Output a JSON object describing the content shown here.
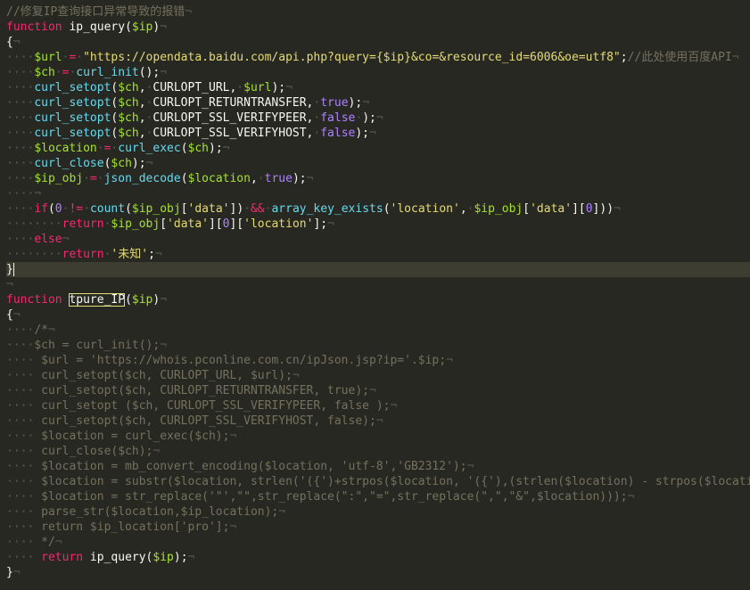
{
  "editor": {
    "language": "php",
    "theme_colors": {
      "background": "#272822",
      "current_line": "#3e3d32",
      "keyword": "#f92672",
      "function": "#66d9ef",
      "variable": "#a6e22e",
      "string": "#e6db74",
      "constant": "#ae81ff",
      "comment": "#75715e",
      "whitespace": "#595a4e"
    },
    "lines": [
      [
        [
          "com",
          "//修复IP查询接口异常导致的报错"
        ],
        [
          "ws",
          "¬"
        ]
      ],
      [
        [
          "kw",
          "function"
        ],
        [
          "plain",
          " ip_query("
        ],
        [
          "var",
          "$ip"
        ],
        [
          "plain",
          ")"
        ],
        [
          "ws",
          "¬"
        ]
      ],
      [
        [
          "plain",
          "{"
        ],
        [
          "ws",
          "¬"
        ]
      ],
      [
        [
          "ws",
          "····"
        ],
        [
          "var",
          "$url"
        ],
        [
          "ws",
          "·"
        ],
        [
          "kw",
          "="
        ],
        [
          "ws",
          "·"
        ],
        [
          "str",
          "\"https://opendata.baidu.com/api.php?query={$ip}&co=&resource_id=6006&oe=utf8\""
        ],
        [
          "plain",
          ";"
        ],
        [
          "com",
          "//此处使用百度API"
        ],
        [
          "ws",
          "¬"
        ]
      ],
      [
        [
          "ws",
          "····"
        ],
        [
          "var",
          "$ch"
        ],
        [
          "ws",
          "·"
        ],
        [
          "kw",
          "="
        ],
        [
          "ws",
          "·"
        ],
        [
          "fn",
          "curl_init"
        ],
        [
          "plain",
          "();"
        ],
        [
          "ws",
          "¬"
        ]
      ],
      [
        [
          "ws",
          "····"
        ],
        [
          "fn",
          "curl_setopt"
        ],
        [
          "plain",
          "("
        ],
        [
          "var",
          "$ch"
        ],
        [
          "plain",
          ","
        ],
        [
          "ws",
          "·"
        ],
        [
          "plain",
          "CURLOPT_URL,"
        ],
        [
          "ws",
          "·"
        ],
        [
          "var",
          "$url"
        ],
        [
          "plain",
          ");"
        ],
        [
          "ws",
          "¬"
        ]
      ],
      [
        [
          "ws",
          "····"
        ],
        [
          "fn",
          "curl_setopt"
        ],
        [
          "plain",
          "("
        ],
        [
          "var",
          "$ch"
        ],
        [
          "plain",
          ","
        ],
        [
          "ws",
          "·"
        ],
        [
          "plain",
          "CURLOPT_RETURNTRANSFER,"
        ],
        [
          "ws",
          "·"
        ],
        [
          "const",
          "true"
        ],
        [
          "plain",
          ");"
        ],
        [
          "ws",
          "¬"
        ]
      ],
      [
        [
          "ws",
          "····"
        ],
        [
          "fn",
          "curl_setopt"
        ],
        [
          "plain",
          "("
        ],
        [
          "var",
          "$ch"
        ],
        [
          "plain",
          ","
        ],
        [
          "ws",
          "·"
        ],
        [
          "plain",
          "CURLOPT_SSL_VERIFYPEER,"
        ],
        [
          "ws",
          "·"
        ],
        [
          "const",
          "false"
        ],
        [
          "ws",
          "·"
        ],
        [
          "plain",
          ");"
        ],
        [
          "ws",
          "¬"
        ]
      ],
      [
        [
          "ws",
          "····"
        ],
        [
          "fn",
          "curl_setopt"
        ],
        [
          "plain",
          "("
        ],
        [
          "var",
          "$ch"
        ],
        [
          "plain",
          ","
        ],
        [
          "ws",
          "·"
        ],
        [
          "plain",
          "CURLOPT_SSL_VERIFYHOST,"
        ],
        [
          "ws",
          "·"
        ],
        [
          "const",
          "false"
        ],
        [
          "plain",
          ");"
        ],
        [
          "ws",
          "¬"
        ]
      ],
      [
        [
          "ws",
          "····"
        ],
        [
          "var",
          "$location"
        ],
        [
          "ws",
          "·"
        ],
        [
          "kw",
          "="
        ],
        [
          "ws",
          "·"
        ],
        [
          "fn",
          "curl_exec"
        ],
        [
          "plain",
          "("
        ],
        [
          "var",
          "$ch"
        ],
        [
          "plain",
          ");"
        ],
        [
          "ws",
          "¬"
        ]
      ],
      [
        [
          "ws",
          "····"
        ],
        [
          "fn",
          "curl_close"
        ],
        [
          "plain",
          "("
        ],
        [
          "var",
          "$ch"
        ],
        [
          "plain",
          ");"
        ],
        [
          "ws",
          "¬"
        ]
      ],
      [
        [
          "ws",
          "····"
        ],
        [
          "var",
          "$ip_obj"
        ],
        [
          "ws",
          "·"
        ],
        [
          "kw",
          "="
        ],
        [
          "ws",
          "·"
        ],
        [
          "fn",
          "json_decode"
        ],
        [
          "plain",
          "("
        ],
        [
          "var",
          "$location"
        ],
        [
          "plain",
          ","
        ],
        [
          "ws",
          "·"
        ],
        [
          "const",
          "true"
        ],
        [
          "plain",
          ");"
        ],
        [
          "ws",
          "¬"
        ]
      ],
      [
        [
          "ws",
          "····¬"
        ]
      ],
      [
        [
          "ws",
          "····"
        ],
        [
          "kw",
          "if"
        ],
        [
          "plain",
          "("
        ],
        [
          "const",
          "0"
        ],
        [
          "ws",
          "·"
        ],
        [
          "kw",
          "!="
        ],
        [
          "ws",
          "·"
        ],
        [
          "fn",
          "count"
        ],
        [
          "plain",
          "("
        ],
        [
          "var",
          "$ip_obj"
        ],
        [
          "plain",
          "["
        ],
        [
          "str",
          "'data'"
        ],
        [
          "plain",
          "])"
        ],
        [
          "ws",
          "·"
        ],
        [
          "kw",
          "&&"
        ],
        [
          "ws",
          "·"
        ],
        [
          "fn",
          "array_key_exists"
        ],
        [
          "plain",
          "("
        ],
        [
          "str",
          "'location'"
        ],
        [
          "plain",
          ","
        ],
        [
          "ws",
          "·"
        ],
        [
          "var",
          "$ip_obj"
        ],
        [
          "plain",
          "["
        ],
        [
          "str",
          "'data'"
        ],
        [
          "plain",
          "]["
        ],
        [
          "const",
          "0"
        ],
        [
          "plain",
          "]))"
        ],
        [
          "ws",
          "¬"
        ]
      ],
      [
        [
          "ws",
          "········"
        ],
        [
          "kw",
          "return"
        ],
        [
          "ws",
          "·"
        ],
        [
          "var",
          "$ip_obj"
        ],
        [
          "plain",
          "["
        ],
        [
          "str",
          "'data'"
        ],
        [
          "plain",
          "]["
        ],
        [
          "const",
          "0"
        ],
        [
          "plain",
          "]["
        ],
        [
          "str",
          "'location'"
        ],
        [
          "plain",
          "];"
        ],
        [
          "ws",
          "¬"
        ]
      ],
      [
        [
          "ws",
          "····"
        ],
        [
          "kw",
          "else"
        ],
        [
          "ws",
          "¬"
        ]
      ],
      [
        [
          "ws",
          "········"
        ],
        [
          "kw",
          "return"
        ],
        [
          "ws",
          "·"
        ],
        [
          "str",
          "'未知'"
        ],
        [
          "plain",
          ";"
        ],
        [
          "ws",
          "¬"
        ]
      ],
      [
        [
          "plain",
          "}"
        ],
        [
          "caret",
          ""
        ]
      ],
      [
        [
          "ws",
          "¬"
        ]
      ],
      [
        [
          "kw",
          "function"
        ],
        [
          "plain",
          " "
        ],
        [
          "hl",
          "tpure_IP"
        ],
        [
          "plain",
          "("
        ],
        [
          "var",
          "$ip"
        ],
        [
          "plain",
          ")"
        ],
        [
          "ws",
          "¬"
        ]
      ],
      [
        [
          "plain",
          "{"
        ],
        [
          "ws",
          "¬"
        ]
      ],
      [
        [
          "ws",
          "····"
        ],
        [
          "com",
          "/*"
        ],
        [
          "ws",
          "¬"
        ]
      ],
      [
        [
          "ws",
          "····"
        ],
        [
          "com",
          "$ch = curl_init();"
        ],
        [
          "ws",
          "¬"
        ]
      ],
      [
        [
          "ws",
          "····"
        ],
        [
          "com",
          " $url = 'https://whois.pconline.com.cn/ipJson.jsp?ip='.$ip;"
        ],
        [
          "ws",
          "¬"
        ]
      ],
      [
        [
          "ws",
          "····"
        ],
        [
          "com",
          " curl_setopt($ch, CURLOPT_URL, $url);"
        ],
        [
          "ws",
          "¬"
        ]
      ],
      [
        [
          "ws",
          "····"
        ],
        [
          "com",
          " curl_setopt($ch, CURLOPT_RETURNTRANSFER, true);"
        ],
        [
          "ws",
          "¬"
        ]
      ],
      [
        [
          "ws",
          "····"
        ],
        [
          "com",
          " curl_setopt ($ch, CURLOPT_SSL_VERIFYPEER, false );"
        ],
        [
          "ws",
          "¬"
        ]
      ],
      [
        [
          "ws",
          "····"
        ],
        [
          "com",
          " curl_setopt($ch, CURLOPT_SSL_VERIFYHOST, false);"
        ],
        [
          "ws",
          "¬"
        ]
      ],
      [
        [
          "ws",
          "····"
        ],
        [
          "com",
          " $location = curl_exec($ch);"
        ],
        [
          "ws",
          "¬"
        ]
      ],
      [
        [
          "ws",
          "····"
        ],
        [
          "com",
          " curl_close($ch);"
        ],
        [
          "ws",
          "¬"
        ]
      ],
      [
        [
          "ws",
          "····"
        ],
        [
          "com",
          " $location = mb_convert_encoding($location, 'utf-8','GB2312');"
        ],
        [
          "ws",
          "¬"
        ]
      ],
      [
        [
          "ws",
          "····"
        ],
        [
          "com",
          " $location = substr($location, strlen('({')+strpos($location, '({'),(strlen($location) - strpos($location"
        ]
      ],
      [
        [
          "ws",
          "····"
        ],
        [
          "com",
          " $location = str_replace('\"',\"\",str_replace(\":\",\"=\",str_replace(\",\",\"&\",$location)));"
        ],
        [
          "ws",
          "¬"
        ]
      ],
      [
        [
          "ws",
          "····"
        ],
        [
          "com",
          " parse_str($location,$ip_location);"
        ],
        [
          "ws",
          "¬"
        ]
      ],
      [
        [
          "ws",
          "····"
        ],
        [
          "com",
          " return $ip_location['pro'];"
        ],
        [
          "ws",
          "¬"
        ]
      ],
      [
        [
          "ws",
          "····"
        ],
        [
          "com",
          " */"
        ],
        [
          "ws",
          "¬"
        ]
      ],
      [
        [
          "ws",
          "····"
        ],
        [
          "plain",
          " "
        ],
        [
          "kw",
          "return"
        ],
        [
          "plain",
          " ip_query("
        ],
        [
          "var",
          "$ip"
        ],
        [
          "plain",
          ");"
        ],
        [
          "ws",
          "¬"
        ]
      ],
      [
        [
          "plain",
          "}"
        ],
        [
          "ws",
          "¬"
        ]
      ]
    ]
  }
}
